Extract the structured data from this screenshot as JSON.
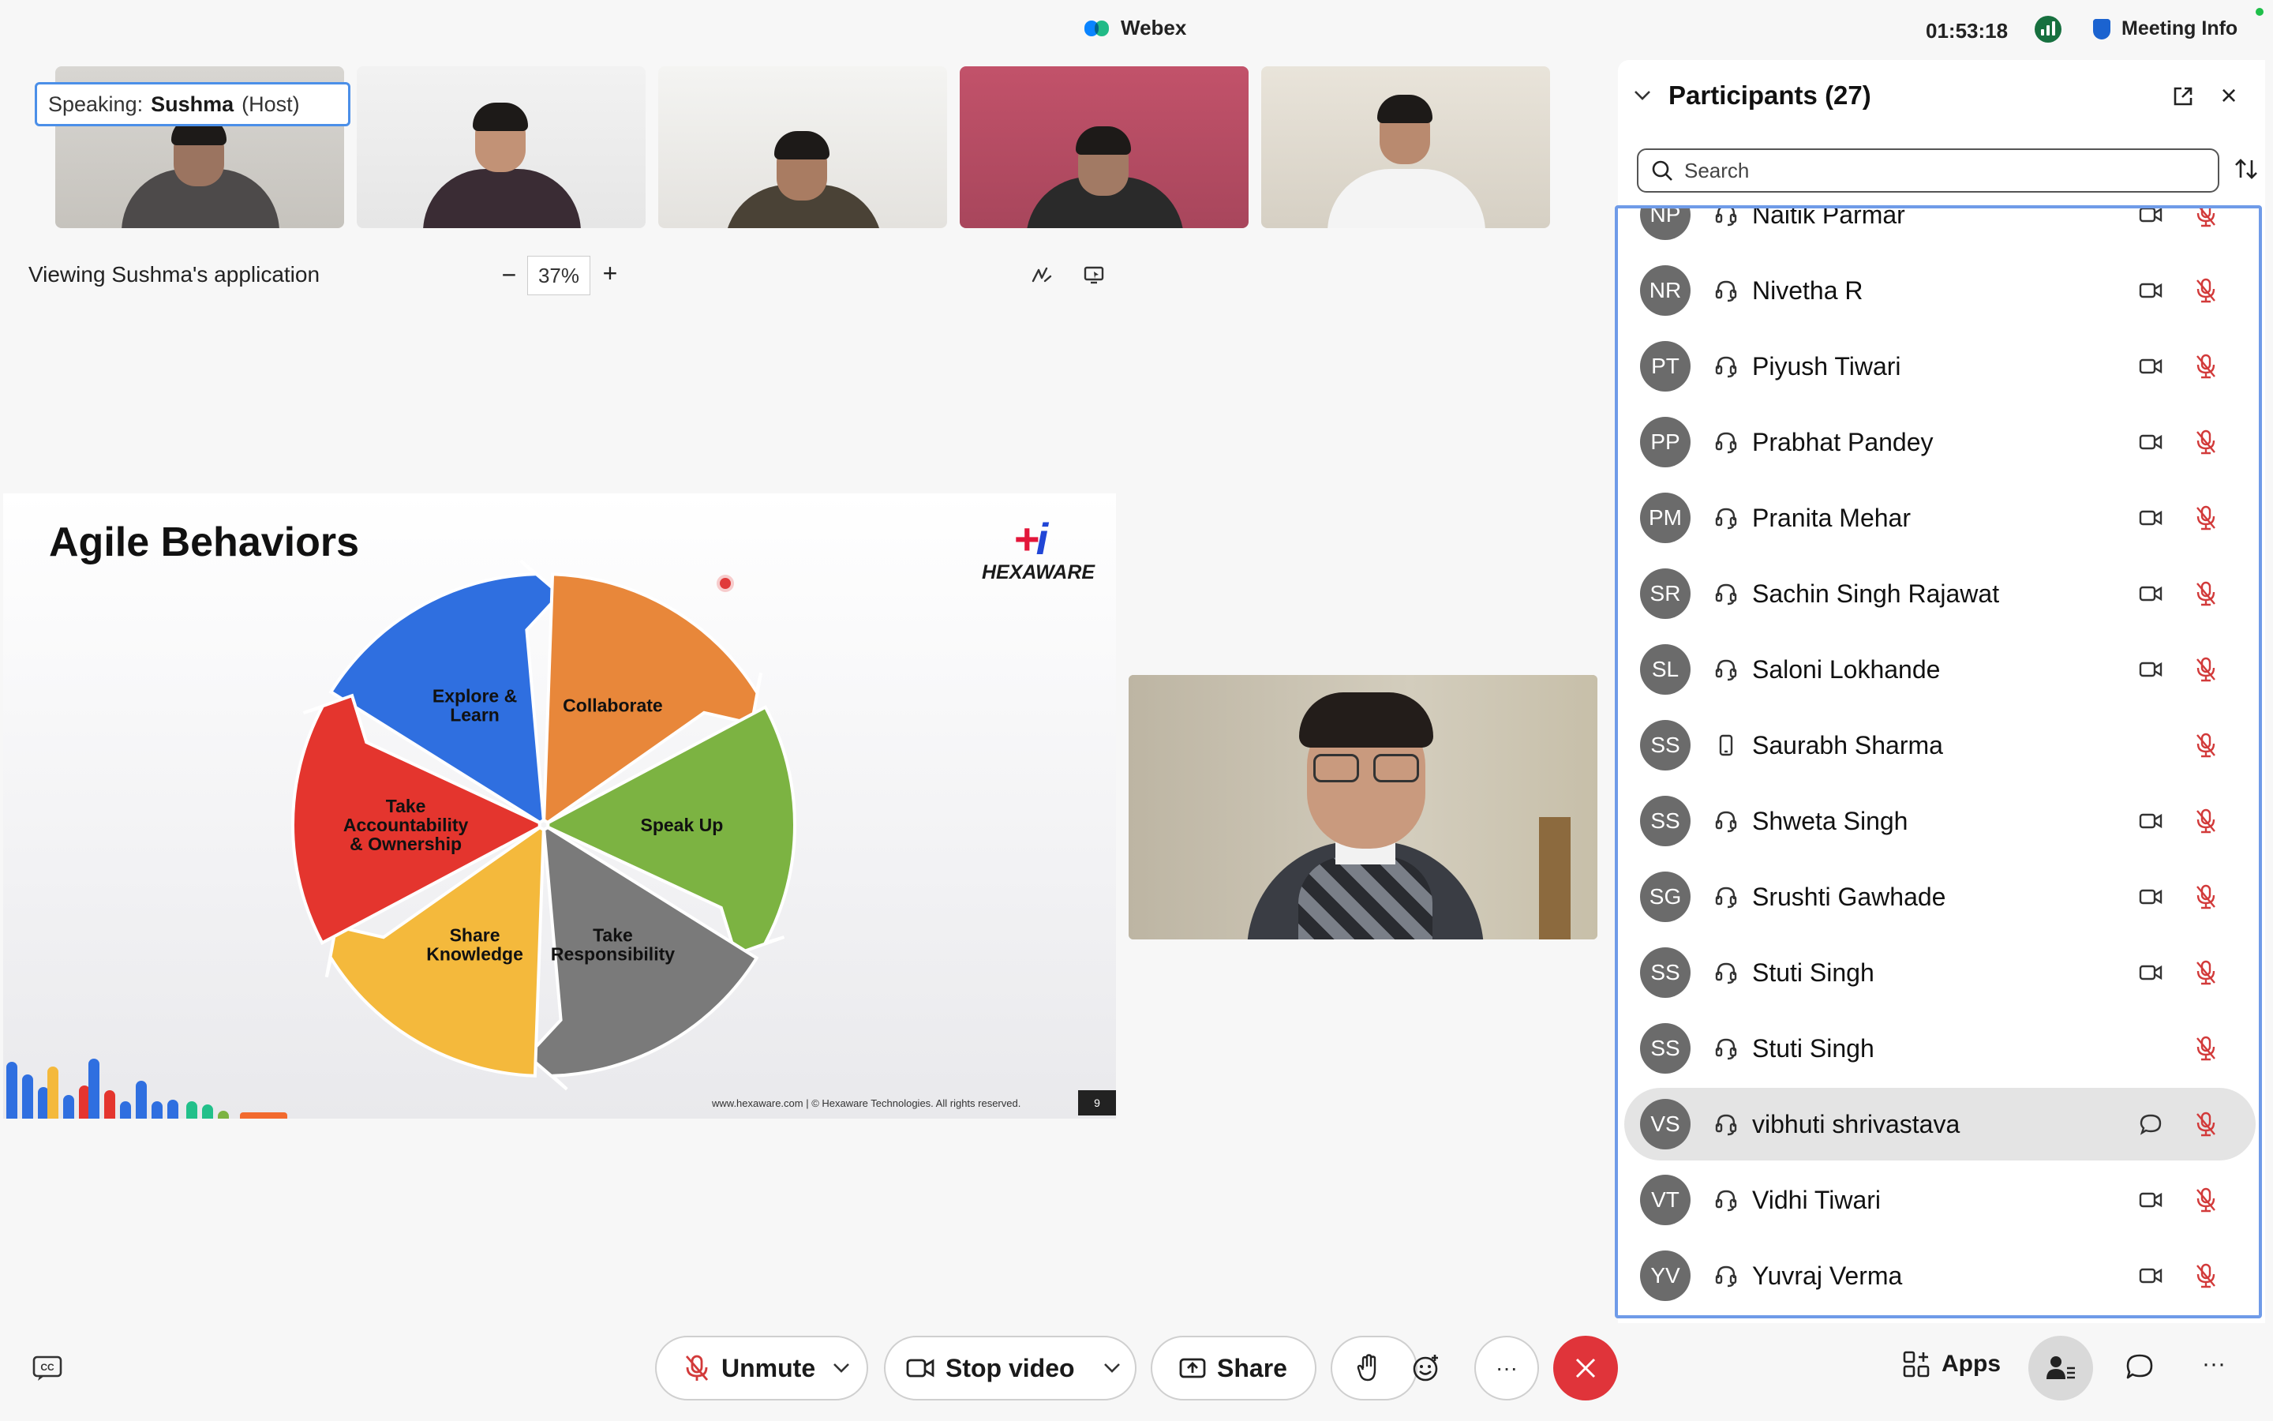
{
  "app": {
    "title": "Webex"
  },
  "topbar": {
    "time": "01:53:18",
    "meeting_info_label": "Meeting Info"
  },
  "speaking": {
    "prefix": "Speaking:",
    "name": "Sushma",
    "role": "(Host)"
  },
  "share": {
    "viewing_text": "Viewing Sushma's application",
    "zoom": "37%",
    "zoom_minus": "−",
    "zoom_plus": "+"
  },
  "slide": {
    "title": "Agile Behaviors",
    "logo_word": "HEXAWARE",
    "segments": [
      "Explore & Learn",
      "Collaborate",
      "Speak Up",
      "Take Responsibility",
      "Share Knowledge",
      "Take Accountability & Ownership"
    ],
    "segment_colors": [
      "#2f6fe0",
      "#e8873a",
      "#7cb342",
      "#7a7a7a",
      "#f4b93c",
      "#e4352e"
    ],
    "footer": "www.hexaware.com  | © Hexaware Technologies. All rights reserved.",
    "page_number": "9"
  },
  "participants": {
    "title": "Participants (27)",
    "search_placeholder": "Search",
    "items": [
      {
        "initials": "NP",
        "name": "Naitik Parmar",
        "device": "headset",
        "video": true,
        "muted": true
      },
      {
        "initials": "NR",
        "name": "Nivetha R",
        "device": "headset",
        "video": true,
        "muted": true
      },
      {
        "initials": "PT",
        "name": "Piyush Tiwari",
        "device": "headset",
        "video": true,
        "muted": true
      },
      {
        "initials": "PP",
        "name": "Prabhat Pandey",
        "device": "headset",
        "video": true,
        "muted": true
      },
      {
        "initials": "PM",
        "name": "Pranita Mehar",
        "device": "headset",
        "video": true,
        "muted": true
      },
      {
        "initials": "SR",
        "name": "Sachin Singh Rajawat",
        "device": "headset",
        "video": true,
        "muted": true
      },
      {
        "initials": "SL",
        "name": "Saloni Lokhande",
        "device": "headset",
        "video": true,
        "muted": true
      },
      {
        "initials": "SS",
        "name": "Saurabh Sharma",
        "device": "phone",
        "video": false,
        "muted": true
      },
      {
        "initials": "SS",
        "name": "Shweta Singh",
        "device": "headset",
        "video": true,
        "muted": true
      },
      {
        "initials": "SG",
        "name": "Srushti Gawhade",
        "device": "headset",
        "video": true,
        "muted": true
      },
      {
        "initials": "SS",
        "name": "Stuti Singh",
        "device": "headset",
        "video": true,
        "muted": true
      },
      {
        "initials": "SS",
        "name": "Stuti Singh",
        "device": "headset",
        "video": false,
        "muted": true
      },
      {
        "initials": "VS",
        "name": "vibhuti shrivastava",
        "device": "headset",
        "video": false,
        "chat": true,
        "muted": true,
        "selected": true
      },
      {
        "initials": "VT",
        "name": "Vidhi Tiwari",
        "device": "headset",
        "video": true,
        "muted": true
      },
      {
        "initials": "YV",
        "name": "Yuvraj Verma",
        "device": "headset",
        "video": true,
        "muted": true
      }
    ]
  },
  "controls": {
    "unmute": "Unmute",
    "stop_video": "Stop video",
    "share": "Share",
    "apps": "Apps",
    "more": "···"
  },
  "colors": {
    "accent": "#4b8fe8",
    "leave": "#e0343a",
    "mute": "#d23a3a",
    "avatar": "#6b6b6b"
  }
}
